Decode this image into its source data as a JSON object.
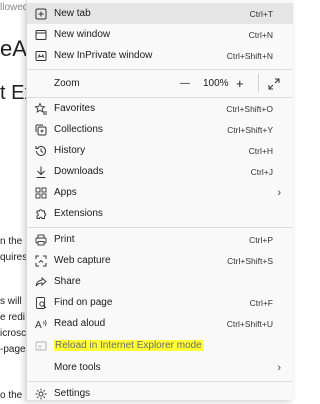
{
  "background": {
    "fragment_top": "llowed",
    "fragment_title1": "eAll",
    "fragment_title2": "t Exp",
    "lines": [
      "n the",
      "quires",
      "s will",
      "e redi",
      "icrosc",
      "-page",
      "o the"
    ]
  },
  "menu": {
    "new_tab": {
      "label": "New tab",
      "shortcut": "Ctrl+T"
    },
    "new_window": {
      "label": "New window",
      "shortcut": "Ctrl+N"
    },
    "new_inprivate": {
      "label": "New InPrivate window",
      "shortcut": "Ctrl+Shift+N"
    },
    "zoom": {
      "label": "Zoom",
      "minus": "—",
      "value": "100%",
      "plus": "+"
    },
    "favorites": {
      "label": "Favorites",
      "shortcut": "Ctrl+Shift+O"
    },
    "collections": {
      "label": "Collections",
      "shortcut": "Ctrl+Shift+Y"
    },
    "history": {
      "label": "History",
      "shortcut": "Ctrl+H"
    },
    "downloads": {
      "label": "Downloads",
      "shortcut": "Ctrl+J"
    },
    "apps": {
      "label": "Apps"
    },
    "extensions": {
      "label": "Extensions"
    },
    "print": {
      "label": "Print",
      "shortcut": "Ctrl+P"
    },
    "web_capture": {
      "label": "Web capture",
      "shortcut": "Ctrl+Shift+S"
    },
    "share": {
      "label": "Share"
    },
    "find_on_page": {
      "label": "Find on page",
      "shortcut": "Ctrl+F"
    },
    "read_aloud": {
      "label": "Read aloud",
      "shortcut": "Ctrl+Shift+U"
    },
    "reload_ie": {
      "label": "Reload in Internet Explorer mode"
    },
    "more_tools": {
      "label": "More tools"
    },
    "settings": {
      "label": "Settings"
    },
    "submenu_arrow": "›"
  },
  "colors": {
    "highlight": "#ffff33",
    "hover": "#e5e5e5",
    "menu_bg": "#f9f9f9"
  }
}
